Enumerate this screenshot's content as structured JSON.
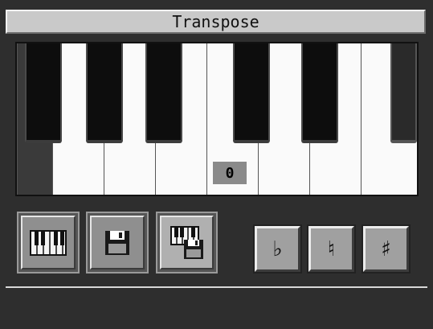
{
  "window": {
    "title": "Transpose"
  },
  "transpose": {
    "value": "0"
  },
  "buttons": {
    "keyboard_mode": {
      "icon": "piano-keys-icon"
    },
    "song_mode": {
      "icon": "floppy-disk-icon"
    },
    "keyboard_and_song_mode": {
      "icon": "keyboard-and-disk-icon",
      "selected": true
    },
    "flat": {
      "label": "♭"
    },
    "natural": {
      "label": "♮"
    },
    "sharp": {
      "label": "♯"
    }
  },
  "colors": {
    "background": "#2e2e2e",
    "title_bar": "#c9c9c9",
    "white_key": "#fafafa",
    "black_key": "#0d0d0d",
    "display": "#8a8a8a"
  }
}
